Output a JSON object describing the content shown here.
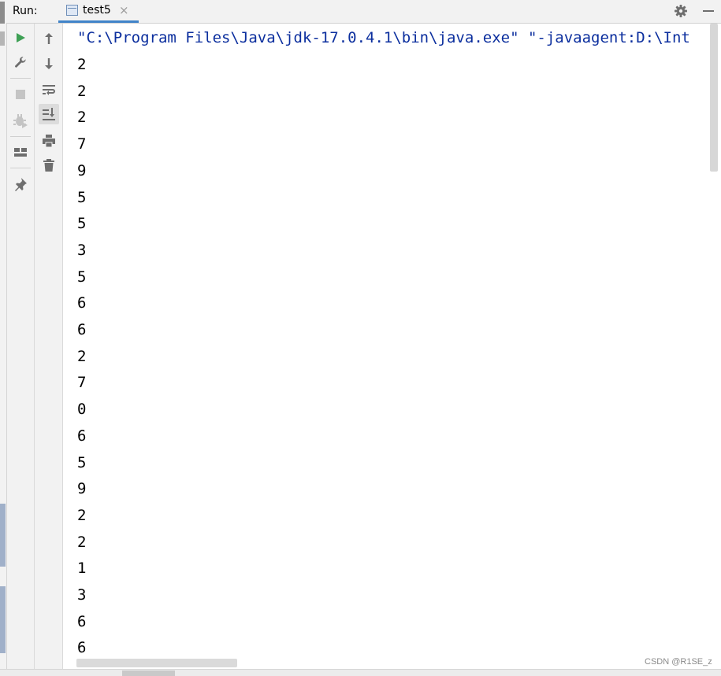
{
  "header": {
    "run_label": "Run:",
    "tab": {
      "label": "test5",
      "close_glyph": "×",
      "icon": "run-config-icon"
    },
    "actions": [
      "gear-icon",
      "minimize-icon"
    ]
  },
  "toolbar_left": [
    "run-icon",
    "wrench-icon",
    "stop-icon",
    "debug-disabled-icon",
    "layout-icon",
    "pin-icon"
  ],
  "toolbar_right": [
    "arrow-up-icon",
    "arrow-down-icon",
    "soft-wrap-icon",
    "scroll-to-end-icon",
    "print-icon",
    "trash-icon"
  ],
  "console": {
    "command_line": "\"C:\\Program Files\\Java\\jdk-17.0.4.1\\bin\\java.exe\" \"-javaagent:D:\\Int",
    "output": [
      "2",
      "2",
      "2",
      "7",
      "9",
      "5",
      "5",
      "3",
      "5",
      "6",
      "6",
      "2",
      "7",
      "0",
      "6",
      "5",
      "9",
      "2",
      "2",
      "1",
      "3",
      "6",
      "6"
    ]
  },
  "watermark": "CSDN @R1SE_z",
  "colors": {
    "command_text": "#0c2f9e",
    "run_green": "#3ea055",
    "tab_underline": "#4083c9",
    "toolbar_bg": "#f2f2f2"
  }
}
